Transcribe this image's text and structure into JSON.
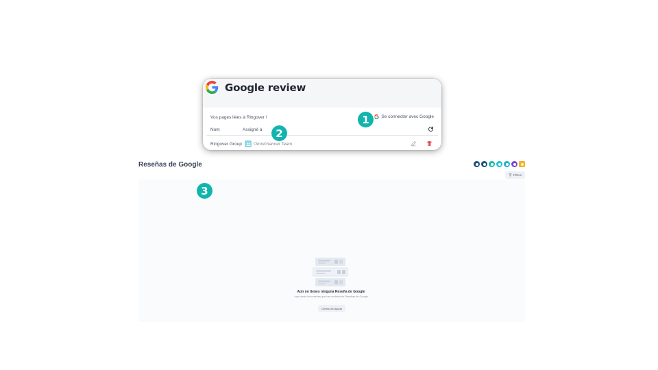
{
  "card": {
    "title": "Google review",
    "linked_pages": "Vos pages liées à Ringover !",
    "connect_label": "Se connecter avec Google",
    "columns": {
      "name": "Nom",
      "assigned": "Assigné à"
    },
    "row": {
      "name": "Ringover Group",
      "team": "Omnichannel Team"
    }
  },
  "markers": {
    "m1": "1",
    "m2": "2",
    "m3": "3"
  },
  "page": {
    "title": "Reseñas de Google",
    "filters_label": "Filtros",
    "empty_title": "Aún no tienes ninguna Reseña de Google",
    "empty_subtitle": "Aquí verás las reseñas que has recibido en Reseñas de Google",
    "help_button": "Centro de Ayuda"
  },
  "colors": {
    "accent": "#12b5ad",
    "channels": [
      "#1d4f7a",
      "#1d4f7a",
      "#19b6ad",
      "#22c3d6",
      "#1fb3c9",
      "#7a43d8",
      "#f3b12c"
    ]
  }
}
